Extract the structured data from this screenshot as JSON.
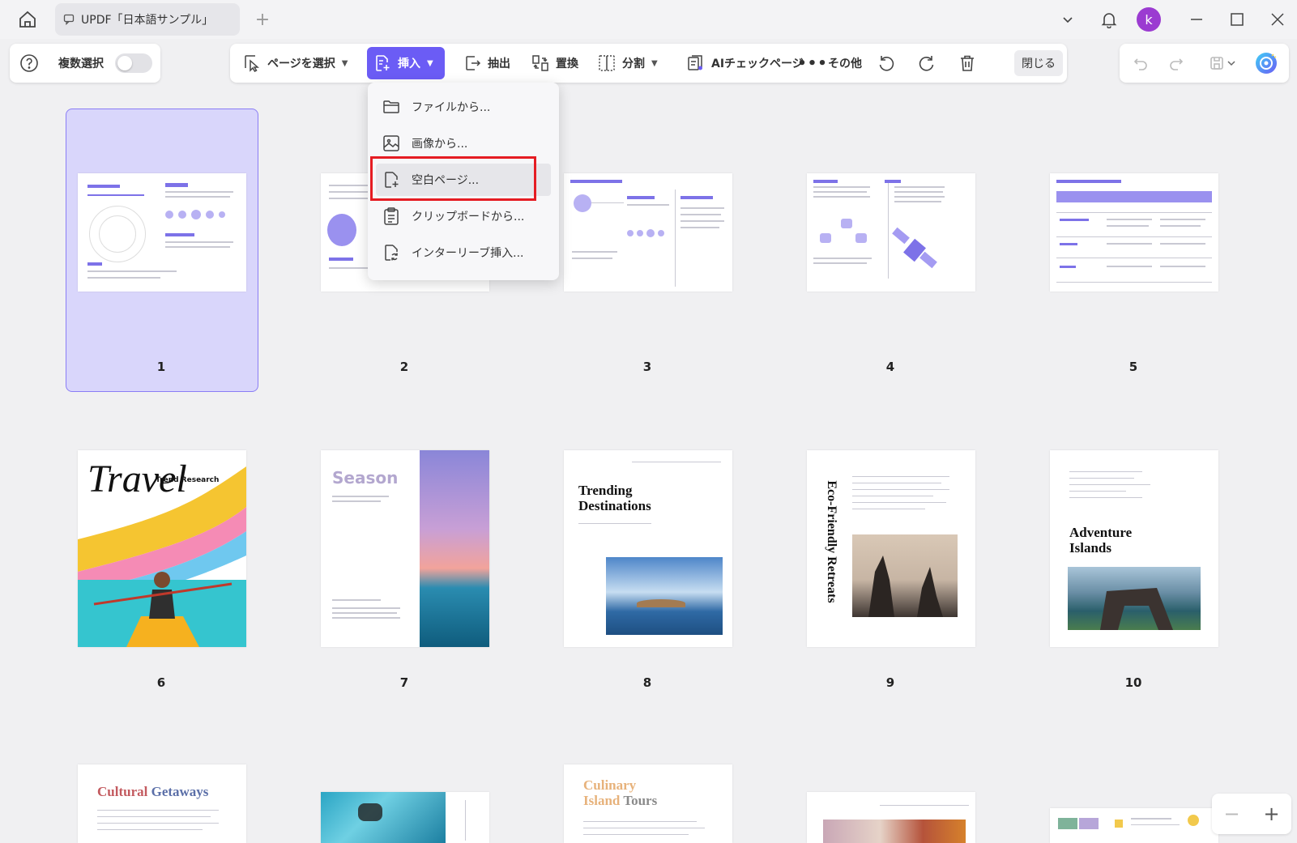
{
  "titlebar": {
    "tab_title": "UPDF「日本語サンプル」",
    "avatar_letter": "k"
  },
  "left_panel": {
    "multi_select_label": "複数選択"
  },
  "toolbar": {
    "select_page": "ページを選択",
    "insert": "挿入",
    "extract": "抽出",
    "replace": "置換",
    "split": "分割",
    "ai_check": "AIチェックページ",
    "more": "その他",
    "close": "閉じる"
  },
  "insert_menu": {
    "items": [
      {
        "label": "ファイルから...",
        "icon": "folder-icon"
      },
      {
        "label": "画像から...",
        "icon": "image-icon"
      },
      {
        "label": "空白ページ...",
        "icon": "blank-page-icon"
      },
      {
        "label": "クリップボードから...",
        "icon": "clipboard-icon"
      },
      {
        "label": "インターリーブ挿入...",
        "icon": "interleave-icon"
      }
    ],
    "highlighted_index": 2
  },
  "pages": [
    {
      "number": "1",
      "selected": true
    },
    {
      "number": "2"
    },
    {
      "number": "3"
    },
    {
      "number": "4"
    },
    {
      "number": "5"
    },
    {
      "number": "6"
    },
    {
      "number": "7"
    },
    {
      "number": "8"
    },
    {
      "number": "9"
    },
    {
      "number": "10"
    }
  ],
  "thumbnails": {
    "p6": {
      "title": "Travel",
      "subtitle": "Trend Research"
    },
    "p7": {
      "title": "Season"
    },
    "p8": {
      "title": "Trending Destinations"
    },
    "p9": {
      "title": "Eco-Friendly Retreats"
    },
    "p10": {
      "title": "Adventure Islands"
    },
    "p11": {
      "title_a": "Cultural ",
      "title_b": "Getaways"
    },
    "p13": {
      "title_a": "Culinary",
      "title_b": "Island ",
      "title_c": "Tours"
    }
  },
  "colors": {
    "accent": "#6b5cf5",
    "selection_bg": "#d9d6fb",
    "highlight_border": "#e51c23",
    "avatar": "#9b3bd1"
  }
}
